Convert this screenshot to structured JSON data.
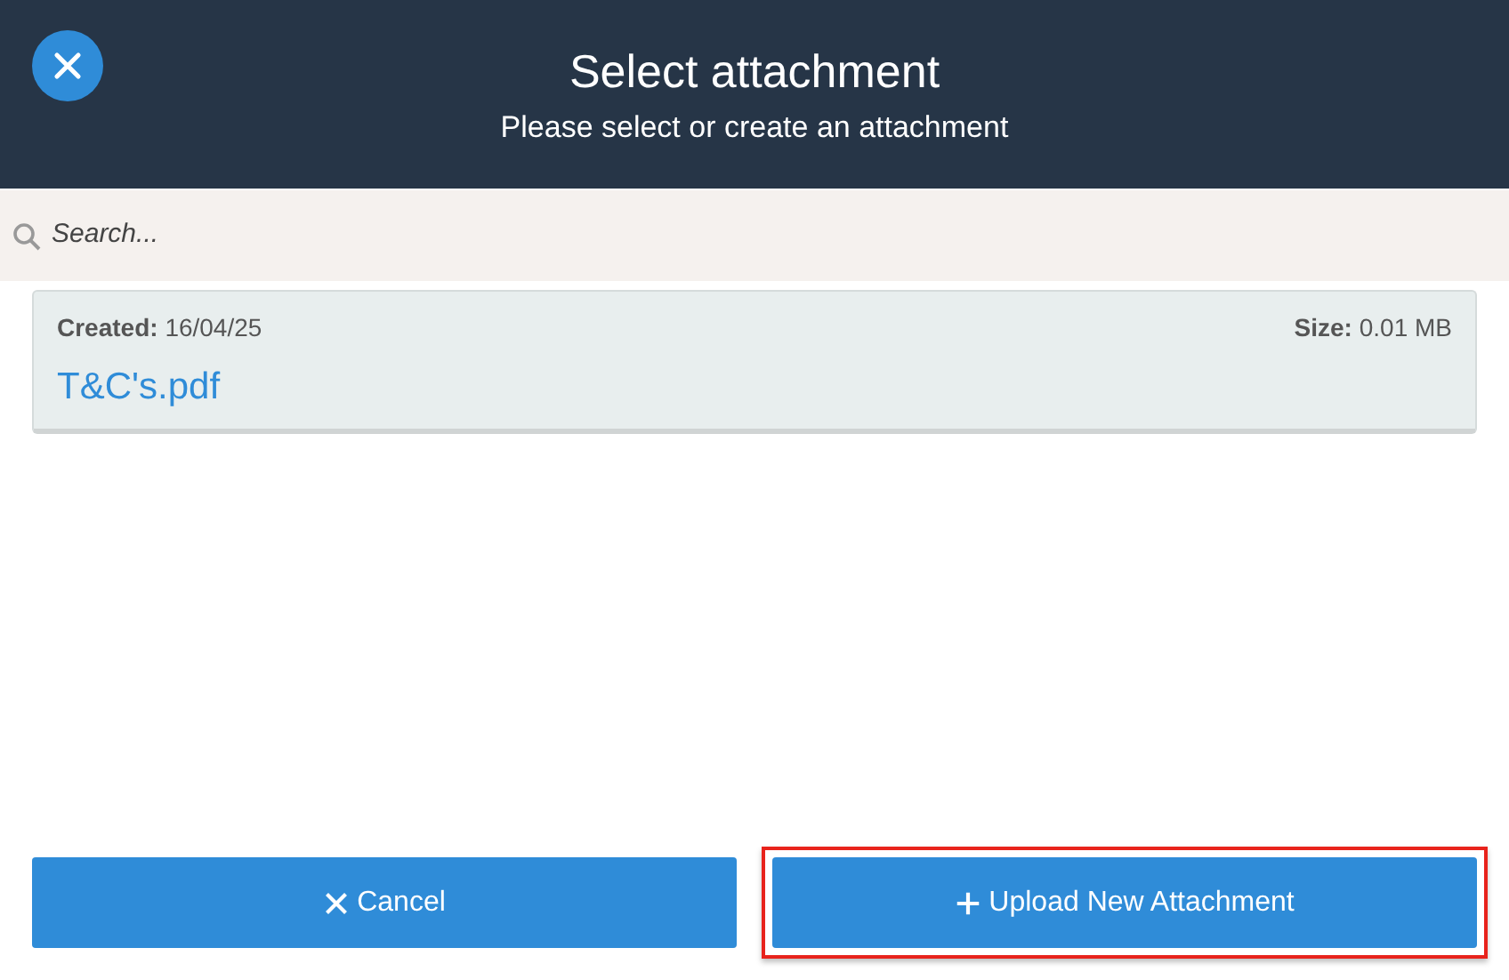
{
  "header": {
    "title": "Select attachment",
    "subtitle": "Please select or create an attachment"
  },
  "search": {
    "placeholder": "Search..."
  },
  "attachments": [
    {
      "created_label": "Created:",
      "created": "16/04/25",
      "size_label": "Size:",
      "size": "0.01 MB",
      "name": "T&C's.pdf"
    }
  ],
  "buttons": [
    {
      "kind": "cancel",
      "label": "Cancel",
      "highlighted": false
    },
    {
      "kind": "upload",
      "label": "Upload New Attachment",
      "highlighted": true
    }
  ]
}
